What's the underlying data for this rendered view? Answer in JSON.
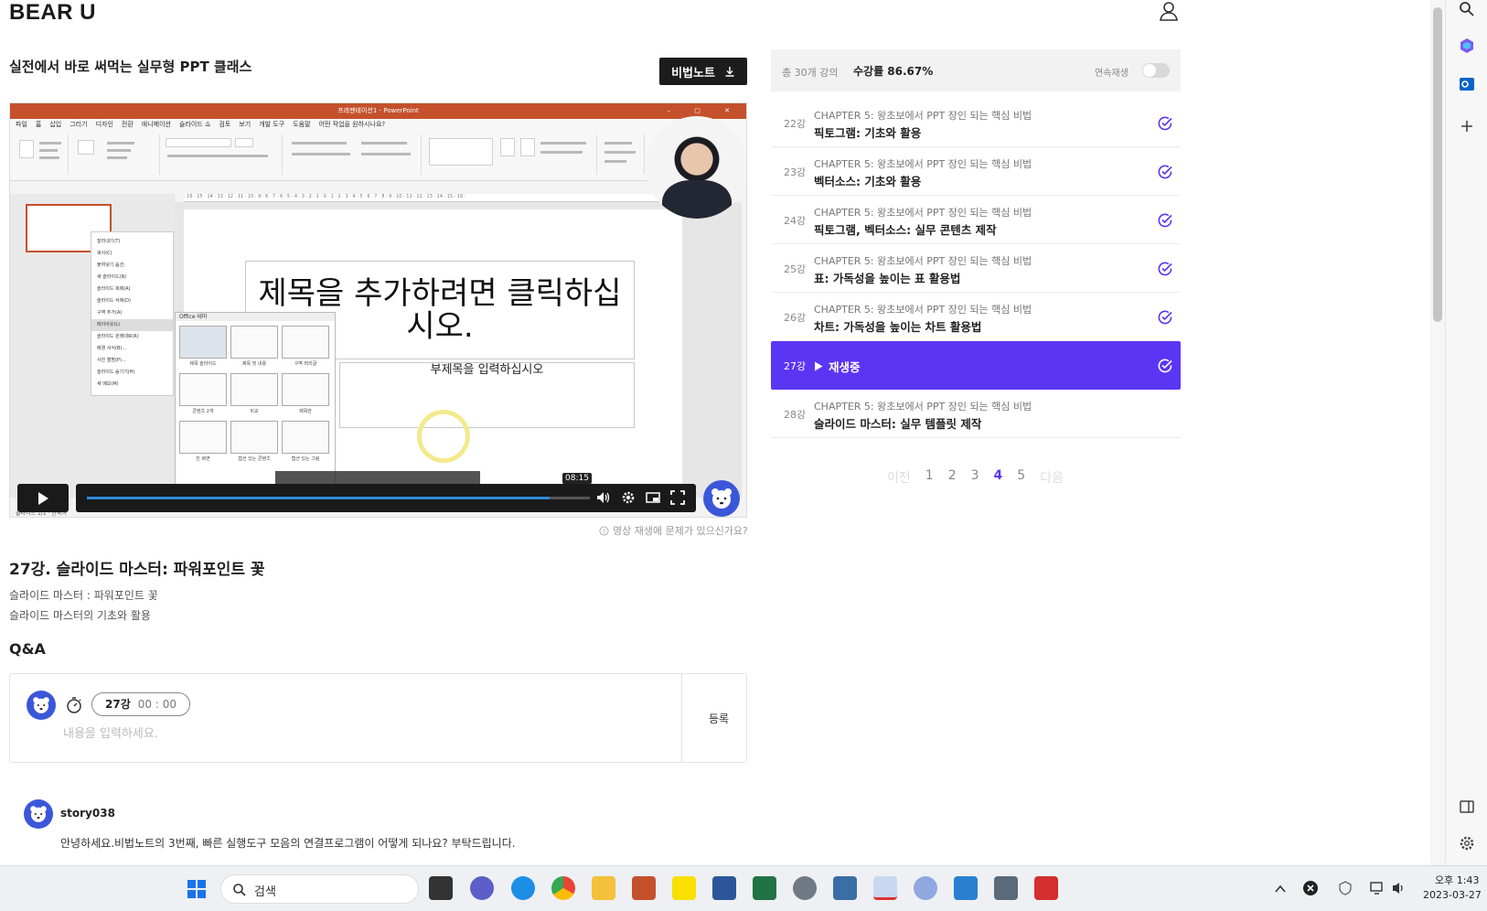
{
  "header": {
    "logo": "BEAR U"
  },
  "course": {
    "title": "실전에서 바로 써먹는 실무형 PPT 클래스",
    "notes_button": "비법노트"
  },
  "video": {
    "ppt_window_title": "프레젠테이션1 - PowerPoint",
    "ppt_menus": [
      "파일",
      "홈",
      "삽입",
      "그리기",
      "디자인",
      "전환",
      "애니메이션",
      "슬라이드 쇼",
      "검토",
      "보기",
      "개발 도구",
      "도움말",
      "어떤 작업을 원하시나요?"
    ],
    "slide_title": "제목을 추가하려면 클릭하십시오.",
    "slide_subtitle": "부제목을 입력하십시오",
    "layout_gallery_title": "Office 테마",
    "layouts": [
      "제목 슬라이드",
      "제목 및 내용",
      "구역 머리글",
      "콘텐츠 2개",
      "비교",
      "제목만",
      "빈 화면",
      "캡션 있는 콘텐츠",
      "캡션 있는 그림"
    ],
    "context_menu": [
      "잘라내기(T)",
      "복사(C)",
      "붙여넣기 옵션:",
      "새 슬라이드(N)",
      "슬라이드 복제(A)",
      "슬라이드 삭제(D)",
      "구역 추가(A)",
      "레이아웃(L)",
      "슬라이드 원래대로(R)",
      "배경 서식(B)...",
      "사진 앨범(P)...",
      "슬라이드 숨기기(H)",
      "새 메모(M)"
    ],
    "timestamp": "08:15",
    "progress": 0.92,
    "report_link": "영상 재생에 문제가 있으신가요?"
  },
  "lecture": {
    "title": "27강. 슬라이드 마스터: 파워포인트 꽃",
    "desc_lines": [
      "슬라이드 마스터 : 파워포인트 꽃",
      "슬라이드 마스터의 기초와 활용"
    ]
  },
  "qa": {
    "heading": "Q&A",
    "chip_lecture": "27강",
    "chip_time": "00 : 00",
    "placeholder": "내용을 입력하세요.",
    "submit_label": "등록"
  },
  "comments": [
    {
      "user": "story038",
      "text": "안녕하세요.비법노트의 3번째, 빠른 실행도구 모음의 연결프로그램이 어떻게 되나요? 부탁드립니다."
    }
  ],
  "panel": {
    "total": "총 30개 강의",
    "progress_label": "수강률 86.67%",
    "autoplay_label": "연속재생",
    "lectures": [
      {
        "num": "22강",
        "chapter": "CHAPTER 5: 왕초보에서 PPT 장인 되는 핵심 비법",
        "name": "픽토그램: 기초와 활용"
      },
      {
        "num": "23강",
        "chapter": "CHAPTER 5: 왕초보에서 PPT 장인 되는 핵심 비법",
        "name": "벡터소스: 기초와 활용"
      },
      {
        "num": "24강",
        "chapter": "CHAPTER 5: 왕초보에서 PPT 장인 되는 핵심 비법",
        "name": "픽토그램, 벡터소스: 실무 콘텐츠 제작"
      },
      {
        "num": "25강",
        "chapter": "CHAPTER 5: 왕초보에서 PPT 장인 되는 핵심 비법",
        "name": "표: 가독성을 높이는 표 활용법"
      },
      {
        "num": "26강",
        "chapter": "CHAPTER 5: 왕초보에서 PPT 장인 되는 핵심 비법",
        "name": "차트: 가독성을 높이는 차트 활용법"
      }
    ],
    "active": {
      "num": "27강",
      "label": "재생중"
    },
    "after": {
      "num": "28강",
      "chapter": "CHAPTER 5: 왕초보에서 PPT 장인 되는 핵심 비법",
      "name": "슬라이드 마스터: 실무 템플릿 제작"
    },
    "pager": {
      "prev": "이전",
      "pages": [
        "1",
        "2",
        "3",
        "4",
        "5"
      ],
      "current": "4",
      "next": "다음"
    }
  },
  "taskbar": {
    "search_label": "검색",
    "time": "오후 1:43",
    "date": "2023-03-27"
  },
  "colors": {
    "accent": "#5b35f4",
    "brand_blue": "#3b57d9",
    "ppt_orange": "#c4512c"
  }
}
